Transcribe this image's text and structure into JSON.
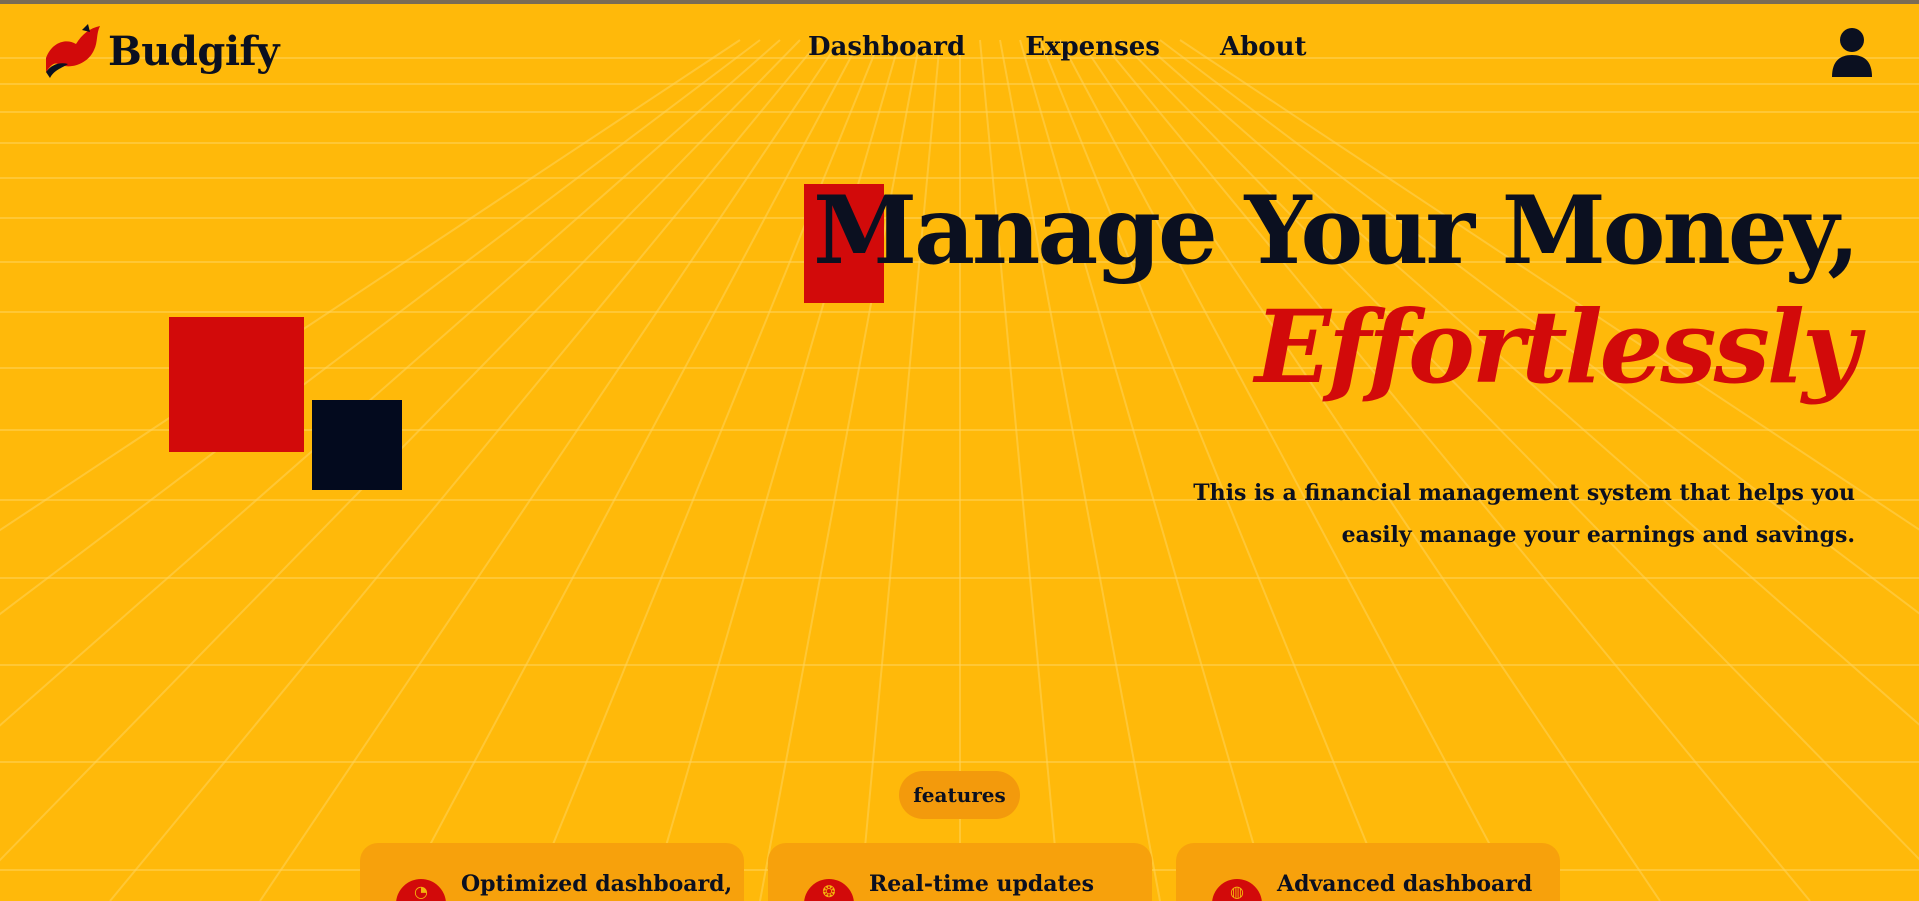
{
  "brand": {
    "name": "Budgify",
    "logo_icon": "fox-tail-logo"
  },
  "nav": {
    "items": [
      {
        "label": "Dashboard"
      },
      {
        "label": "Expenses"
      },
      {
        "label": "About"
      }
    ],
    "user_icon": "user-icon"
  },
  "hero": {
    "title": "Manage Your Money,",
    "accent": "Effortlessly",
    "description": "This is a financial management system that helps you easily manage your earnings and savings."
  },
  "features": {
    "badge": "features",
    "cards": [
      {
        "title": "Optimized dashboard,",
        "icon": "gauge-icon"
      },
      {
        "title": "Real-time updates",
        "icon": "coins-icon"
      },
      {
        "title": "Advanced dashboard",
        "icon": "piggy-bank-icon"
      }
    ]
  },
  "colors": {
    "background": "#ffb90a",
    "accent_red": "#d20a0a",
    "navy": "#0b1020",
    "card": "#f7a10c",
    "pill": "#f39a0c"
  }
}
